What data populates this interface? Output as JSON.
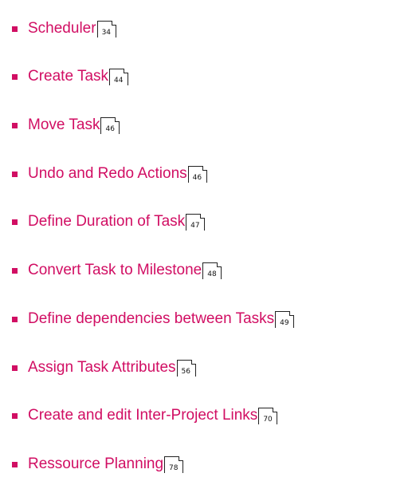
{
  "colors": {
    "link": "#d10e63",
    "bullet": "#d10e63",
    "page_icon_stroke": "#222222"
  },
  "icons": {
    "bullet": "square-bullet-icon",
    "page_reference": "page-reference-icon"
  },
  "toc": {
    "items": [
      {
        "label": "Scheduler",
        "page": "34"
      },
      {
        "label": "Create Task",
        "page": "44"
      },
      {
        "label": "Move Task",
        "page": "46"
      },
      {
        "label": "Undo and Redo Actions",
        "page": "46"
      },
      {
        "label": "Define Duration of Task",
        "page": "47"
      },
      {
        "label": "Convert Task to Milestone",
        "page": "48"
      },
      {
        "label": "Define dependencies between Tasks",
        "page": "49"
      },
      {
        "label": "Assign Task Attributes",
        "page": "56"
      },
      {
        "label": "Create and edit Inter-Project Links",
        "page": "70"
      },
      {
        "label": "Ressource Planning",
        "page": "78"
      }
    ]
  }
}
